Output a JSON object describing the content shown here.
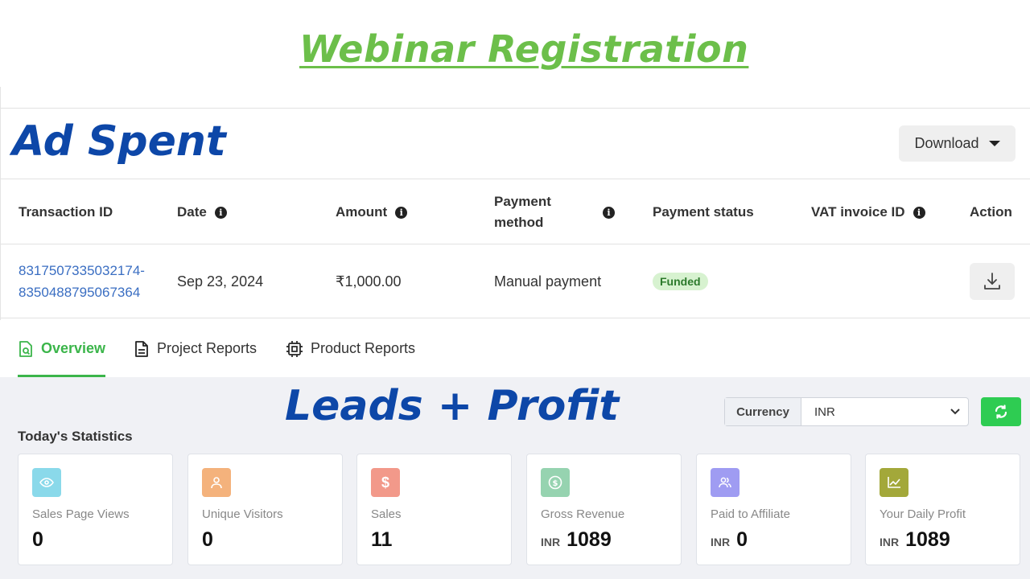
{
  "headline": "Webinar Registration",
  "ad_section": {
    "title": "Ad Spent",
    "download_label": "Download",
    "columns": {
      "transaction_id": "Transaction ID",
      "date": "Date",
      "amount": "Amount",
      "payment_method_1": "Payment",
      "payment_method_2": "method",
      "payment_status": "Payment status",
      "vat_invoice_id": "VAT invoice ID",
      "action": "Action"
    },
    "rows": [
      {
        "transaction_id_1": "8317507335032174-",
        "transaction_id_2": "8350488795067364",
        "date": "Sep 23, 2024",
        "amount": "₹1,000.00",
        "payment_method": "Manual payment",
        "payment_status": "Funded",
        "vat_invoice_id": ""
      }
    ],
    "info_glyph": "i"
  },
  "tabs": [
    {
      "label": "Overview",
      "icon": "search-doc-icon",
      "active": true
    },
    {
      "label": "Project Reports",
      "icon": "document-icon",
      "active": false
    },
    {
      "label": "Product Reports",
      "icon": "chip-icon",
      "active": false
    }
  ],
  "stats_section": {
    "overlay_title": "Leads + Profit",
    "currency_label": "Currency",
    "currency_value": "INR",
    "today_label": "Today's Statistics",
    "cards": [
      {
        "label": "Sales Page Views",
        "value": "0",
        "currency": "",
        "icon": "eye-icon",
        "color": "#8ad9ea"
      },
      {
        "label": "Unique Visitors",
        "value": "0",
        "currency": "",
        "icon": "user-icon",
        "color": "#f4b27c"
      },
      {
        "label": "Sales",
        "value": "11",
        "currency": "",
        "icon": "dollar-icon",
        "color": "#f2998a"
      },
      {
        "label": "Gross Revenue",
        "value": "1089",
        "currency": "INR",
        "icon": "coin-icon",
        "color": "#96d3b0"
      },
      {
        "label": "Paid to Affiliate",
        "value": "0",
        "currency": "INR",
        "icon": "users-icon",
        "color": "#9f9cf2"
      },
      {
        "label": "Your Daily Profit",
        "value": "1089",
        "currency": "INR",
        "icon": "chart-icon",
        "color": "#a3a83a"
      }
    ]
  },
  "colors": {
    "headline_green": "#6cbf4a",
    "title_blue": "#0d47a8",
    "link_blue": "#3a6ec2",
    "active_tab_green": "#3bb54a",
    "refresh_green": "#2ecc52"
  }
}
